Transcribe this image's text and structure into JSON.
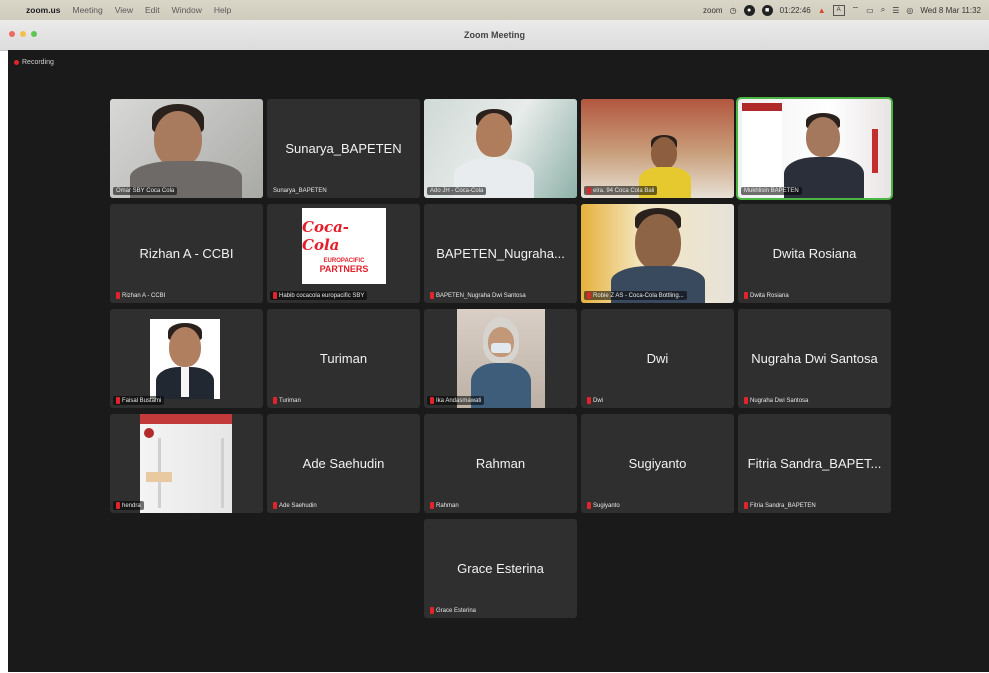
{
  "menubar": {
    "app": "zoom.us",
    "items": [
      "Meeting",
      "View",
      "Edit",
      "Window",
      "Help"
    ],
    "status_brand": "zoom",
    "status_time": "01:22:46",
    "datetime": "Wed 8 Mar 11:32"
  },
  "window": {
    "title": "Zoom Meeting"
  },
  "recording": {
    "label": "Recording"
  },
  "participants": [
    {
      "display": "",
      "label": "Omar SBY Coca Cola"
    },
    {
      "display": "Sunarya_BAPETEN",
      "label": "Sunarya_BAPETEN"
    },
    {
      "display": "",
      "label": "Ado JH - Coca-Cola"
    },
    {
      "display": "",
      "label": "eira. 94 Coca Cola Bali"
    },
    {
      "display": "",
      "label": "Mukhlisin BAPETEN"
    },
    {
      "display": "Rizhan A - CCBI",
      "label": "Rizhan A - CCBI"
    },
    {
      "display": "",
      "label": "Habib cocacola europacific SBY"
    },
    {
      "display": "BAPETEN_Nugraha...",
      "label": "BAPETEN_Nugraha Dwi Santosa"
    },
    {
      "display": "",
      "label": "Robie Z AS - Coca-Cola Bottling..."
    },
    {
      "display": "Dwita Rosiana",
      "label": "Dwita Rosiana"
    },
    {
      "display": "",
      "label": "Faisal Bustami"
    },
    {
      "display": "Turiman",
      "label": "Turiman"
    },
    {
      "display": "",
      "label": "Ika Andasmawati"
    },
    {
      "display": "Dwi",
      "label": "Dwi"
    },
    {
      "display": "Nugraha Dwi Santosa",
      "label": "Nugraha Dwi Santosa"
    },
    {
      "display": "",
      "label": "hendra"
    },
    {
      "display": "Ade Saehudin",
      "label": "Ade Saehudin"
    },
    {
      "display": "Rahman",
      "label": "Rahman"
    },
    {
      "display": "Sugiyanto",
      "label": "Sugiyanto"
    },
    {
      "display": "Fitria Sandra_BAPET...",
      "label": "Fitria Sandra_BAPETEN"
    },
    {
      "display": "Grace Esterina",
      "label": "Grace Esterina"
    }
  ],
  "coca_cola_logo": {
    "brand": "Coca-Cola",
    "line1": "EUROPACIFIC",
    "line2": "PARTNERS"
  },
  "colors": {
    "meeting_bg": "#1a1a1a",
    "tile_bg": "#2f2f2f",
    "active_speaker": "#4bb543",
    "mute": "#e0252a"
  }
}
